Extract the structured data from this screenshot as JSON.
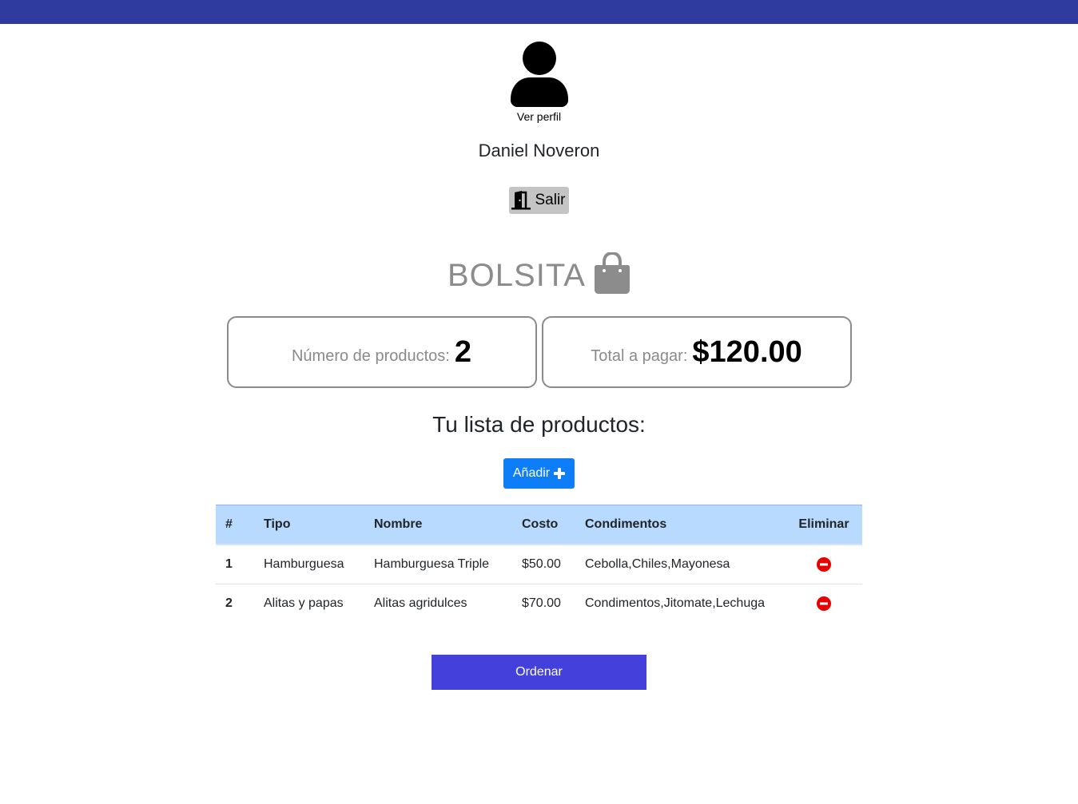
{
  "profile": {
    "avatar_icon": "user-icon",
    "link_label": "Ver perfil",
    "user_name": "Daniel Noveron",
    "logout_label": "Salir",
    "logout_icon": "door-open-icon"
  },
  "bag": {
    "title": "BOLSITA",
    "icon": "shopping-bag-icon",
    "count_label": "Número de productos:",
    "count_value": "2",
    "total_label": "Total a pagar:",
    "total_value": "$120.00"
  },
  "list": {
    "heading": "Tu lista de productos:",
    "add_label": "Añadir",
    "add_icon": "plus-icon"
  },
  "table": {
    "headers": [
      "#",
      "Tipo",
      "Nombre",
      "Costo",
      "Condimentos",
      "Eliminar"
    ],
    "rows": [
      {
        "num": "1",
        "tipo": "Hamburguesa",
        "nombre": "Hamburguesa Triple",
        "costo": "$50.00",
        "condimentos": "Cebolla,Chiles,Mayonesa"
      },
      {
        "num": "2",
        "tipo": "Alitas y papas",
        "nombre": "Alitas agridulces",
        "costo": "$70.00",
        "condimentos": "Condimentos,Jitomate,Lechuga"
      }
    ],
    "delete_icon": "minus-circle-icon"
  },
  "order": {
    "label": "Ordenar"
  },
  "colors": {
    "topbar": "#2f3b9e",
    "add_button": "#0d7ef8",
    "order_button": "#4340dc",
    "table_header": "#b8daff",
    "delete": "#e60000"
  }
}
